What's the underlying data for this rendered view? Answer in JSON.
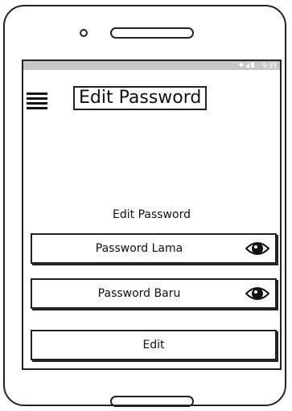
{
  "status_bar": {
    "time": "9:39",
    "icons": "wifi-icon signal-icon battery-icon"
  },
  "app_bar": {
    "menu_icon": "menu-icon",
    "title": "Edit Password"
  },
  "form": {
    "heading": "Edit Password",
    "fields": [
      {
        "label": "Password Lama",
        "icon": "eye-icon"
      },
      {
        "label": "Password Baru",
        "icon": "eye-icon"
      }
    ],
    "submit_label": "Edit"
  }
}
